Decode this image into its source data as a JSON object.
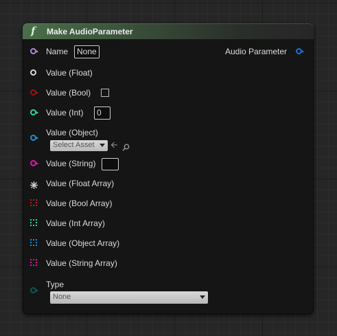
{
  "node": {
    "title": "Make AudioParameter",
    "function_icon": "f"
  },
  "inputs": [
    {
      "label": "Name",
      "value": "None"
    },
    {
      "label": "Value (Float)"
    },
    {
      "label": "Value (Bool)"
    },
    {
      "label": "Value (Int)",
      "value": "0"
    },
    {
      "label": "Value (Object)",
      "select": "Select Asset"
    },
    {
      "label": "Value (String)",
      "value": ""
    },
    {
      "label": "Value (Float Array)"
    },
    {
      "label": "Value (Bool Array)"
    },
    {
      "label": "Value (Int Array)"
    },
    {
      "label": "Value (Object Array)"
    },
    {
      "label": "Value (String Array)"
    },
    {
      "label": "Type",
      "select": "None"
    }
  ],
  "output": {
    "label": "Audio Parameter"
  },
  "colors": {
    "name_pin": "#b784d4",
    "float_pin": "#dcdcdc",
    "bool_pin": "#9a1414",
    "int_pin": "#2fd3a6",
    "object_pin": "#1d8ed8",
    "string_pin": "#e018a8",
    "enum_pin": "#0e5a4e",
    "output_pin": "#1d6fd8"
  },
  "icons": {
    "use_asset": "arrow-left-icon",
    "browse_asset": "search-icon"
  }
}
